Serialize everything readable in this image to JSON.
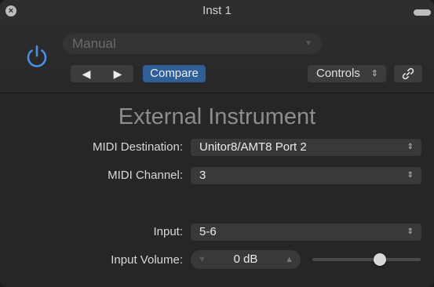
{
  "window": {
    "title": "Inst 1"
  },
  "header": {
    "preset": "Manual",
    "compare_label": "Compare",
    "controls_label": "Controls"
  },
  "plugin": {
    "title": "External Instrument",
    "midi_destination": {
      "label": "MIDI Destination:",
      "value": "Unitor8/AMT8 Port 2"
    },
    "midi_channel": {
      "label": "MIDI Channel:",
      "value": "3"
    },
    "input": {
      "label": "Input:",
      "value": "5-6"
    },
    "input_volume": {
      "label": "Input Volume:",
      "value": "0 dB",
      "slider_fraction": 0.64
    }
  },
  "icons": {
    "close": "close-icon",
    "power": "power-icon",
    "prev": "triangle-left-icon",
    "next": "triangle-right-icon",
    "link": "link-icon"
  },
  "colors": {
    "accent": "#2f5f96",
    "power": "#4a90e2",
    "background": "#262626"
  }
}
